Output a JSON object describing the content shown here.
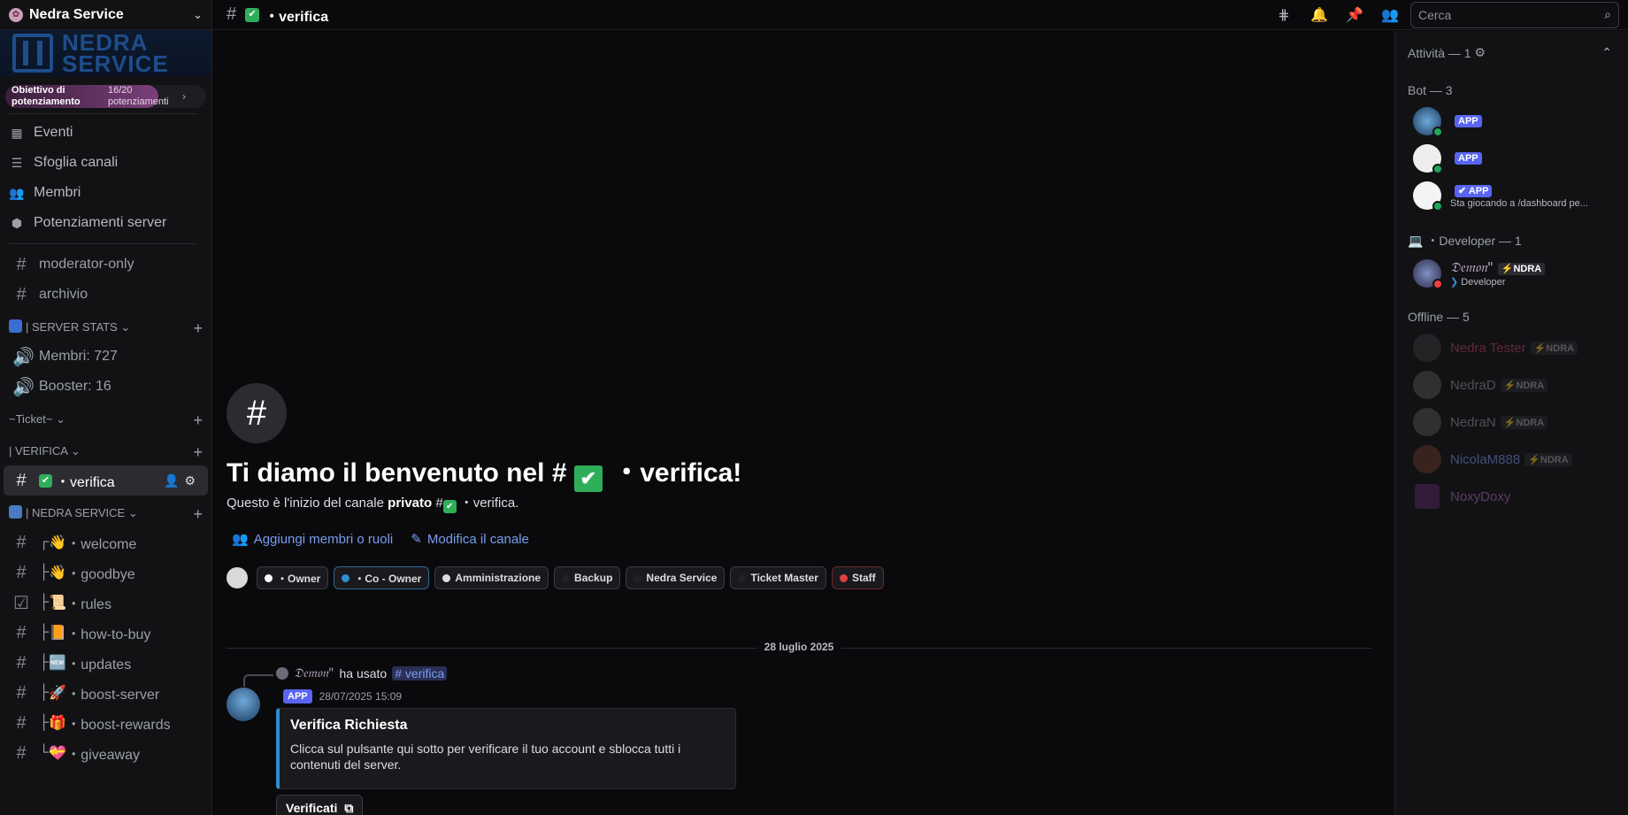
{
  "server": {
    "name": "Nedra Service",
    "banner_text": "NEDRA\nSERVICE"
  },
  "boost": {
    "label": "Obiettivo di potenziamento",
    "count": "16/20 potenziamenti",
    "progress": 0.8
  },
  "nav": [
    {
      "label": "Eventi"
    },
    {
      "label": "Sfoglia canali"
    },
    {
      "label": "Membri"
    },
    {
      "label": "Potenziamenti server"
    }
  ],
  "top_channels": [
    {
      "name": "moderator-only"
    },
    {
      "name": "archivio"
    }
  ],
  "categories": {
    "stats": "| SERVER STATS",
    "ticket": "~Ticket~",
    "verifica": "| VERIFICA",
    "nedra": "| NEDRA SERVICE"
  },
  "stats_channels": [
    {
      "name": "Membri: 727"
    },
    {
      "name": "Booster: 16"
    }
  ],
  "active_channel": {
    "name": "・verifica"
  },
  "nedra_channels": [
    {
      "prefix": "┌",
      "name": "・welcome",
      "emoji": "👋"
    },
    {
      "prefix": "├",
      "name": "・goodbye",
      "emoji": "👋"
    },
    {
      "prefix": "├",
      "name": "・rules",
      "emoji": "📜"
    },
    {
      "prefix": "├",
      "name": "・how-to-buy",
      "emoji": "📙"
    },
    {
      "prefix": "├",
      "name": "・updates",
      "emoji": "🆕"
    },
    {
      "prefix": "├",
      "name": "・boost-server",
      "emoji": "🚀"
    },
    {
      "prefix": "├",
      "name": "・boost-rewards",
      "emoji": "🎁"
    },
    {
      "prefix": "└",
      "name": "・giveaway",
      "emoji": "💝"
    }
  ],
  "topbar": {
    "channel": "・verifica",
    "search_placeholder": "Cerca"
  },
  "welcome": {
    "title": "Ti diamo il benvenuto nel #",
    "title_end": "・verifica!",
    "sub_start": "Questo è l'inizio del canale",
    "sub_bold": "privato",
    "sub_end": "・verifica."
  },
  "actions": {
    "add": "Aggiungi membri o ruoli",
    "edit": "Modifica il canale"
  },
  "roles": [
    {
      "label": "・Owner",
      "color": "#ffffff"
    },
    {
      "label": "・Co - Owner",
      "color": "#2e8fd0"
    },
    {
      "label": "Amministrazione",
      "color": "#dddddd"
    },
    {
      "label": "Backup",
      "color": "#222222"
    },
    {
      "label": "Nedra Service",
      "color": "#222222"
    },
    {
      "label": "Ticket Master",
      "color": "#222222"
    },
    {
      "label": "Staff",
      "color": "#e04040"
    }
  ],
  "date_divider": "28 luglio 2025",
  "reply": {
    "user": "𝔇𝔢𝔪𝔬𝔫\"",
    "text": "ha usato",
    "command": "verifica"
  },
  "message": {
    "author": "",
    "tag": "APP",
    "time": "28/07/2025 15:09"
  },
  "embed": {
    "title": "Verifica Richiesta",
    "description": "Clicca sul pulsante qui sotto per verificare il tuo account e sblocca tutti i contenuti del server."
  },
  "verify_button": "Verificati",
  "members": {
    "activity": "Attività — 1",
    "bot_header": "Bot — 3",
    "bots": [
      {
        "name": "",
        "tag": "APP",
        "status": ""
      },
      {
        "name": "",
        "tag": "APP",
        "status": ""
      },
      {
        "name": "",
        "tag": "✔ APP",
        "status": "Sta giocando a /dashboard pe..."
      }
    ],
    "dev_header": "・Developer — 1",
    "dev": {
      "name": "𝔇𝔢𝔪𝔬𝔫\"",
      "tag": "⚡NDRA",
      "status": "Developer"
    },
    "offline_header": "Offline — 5",
    "offline": [
      {
        "name": "Nedra Tester",
        "tag": "⚡NDRA",
        "color": "#c0406a"
      },
      {
        "name": "NedraD",
        "tag": "⚡NDRA",
        "color": "#9a9aa0"
      },
      {
        "name": "NedraN",
        "tag": "⚡NDRA",
        "color": "#9a9aa0"
      },
      {
        "name": "NicolaM888",
        "tag": "⚡NDRA",
        "color": "#7a9cf0"
      },
      {
        "name": "NoxyDoxy",
        "tag": "",
        "color": "#b070d0"
      }
    ]
  }
}
